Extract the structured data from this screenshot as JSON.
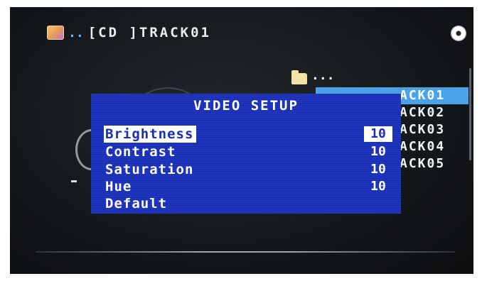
{
  "header": {
    "prefix": "..",
    "source": "[CD  ]TRACK01"
  },
  "browser": {
    "folder_label": "...",
    "tracks": [
      "ACK01",
      "ACK02",
      "ACK03",
      "ACK04",
      "ACK05"
    ],
    "selected_index": 0
  },
  "dialog": {
    "title": "VIDEO SETUP",
    "options": [
      {
        "label": "Brightness",
        "value": "10"
      },
      {
        "label": "Contrast",
        "value": "10"
      },
      {
        "label": "Saturation",
        "value": "10"
      },
      {
        "label": "Hue",
        "value": "10"
      },
      {
        "label": "Default",
        "value": ""
      }
    ],
    "selected_option": "Brightness"
  },
  "colors": {
    "dialog_bg": "#1a2fb8",
    "highlight": "#4aa3e8",
    "screen_bg": "#15181b"
  },
  "icons": {
    "top_left": "media-folder-icon",
    "top_right": "disc-icon",
    "browser": "folder-icon"
  }
}
